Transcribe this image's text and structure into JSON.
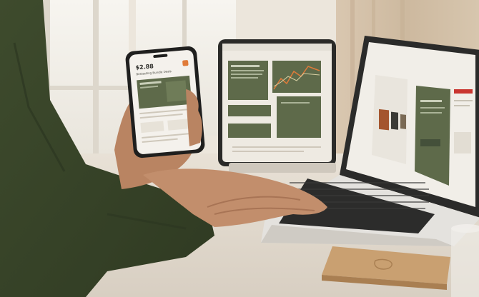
{
  "phone": {
    "price": "$2.88",
    "subtitle": "Bestselling Bundle Deals"
  },
  "colors": {
    "olive_panel": "#5e6a4a",
    "sleeve": "#3d4a2c",
    "wall": "#efe9df",
    "desk": "#e6ddd0",
    "coaster": "#c9a071",
    "accent_orange": "#e07b39"
  }
}
